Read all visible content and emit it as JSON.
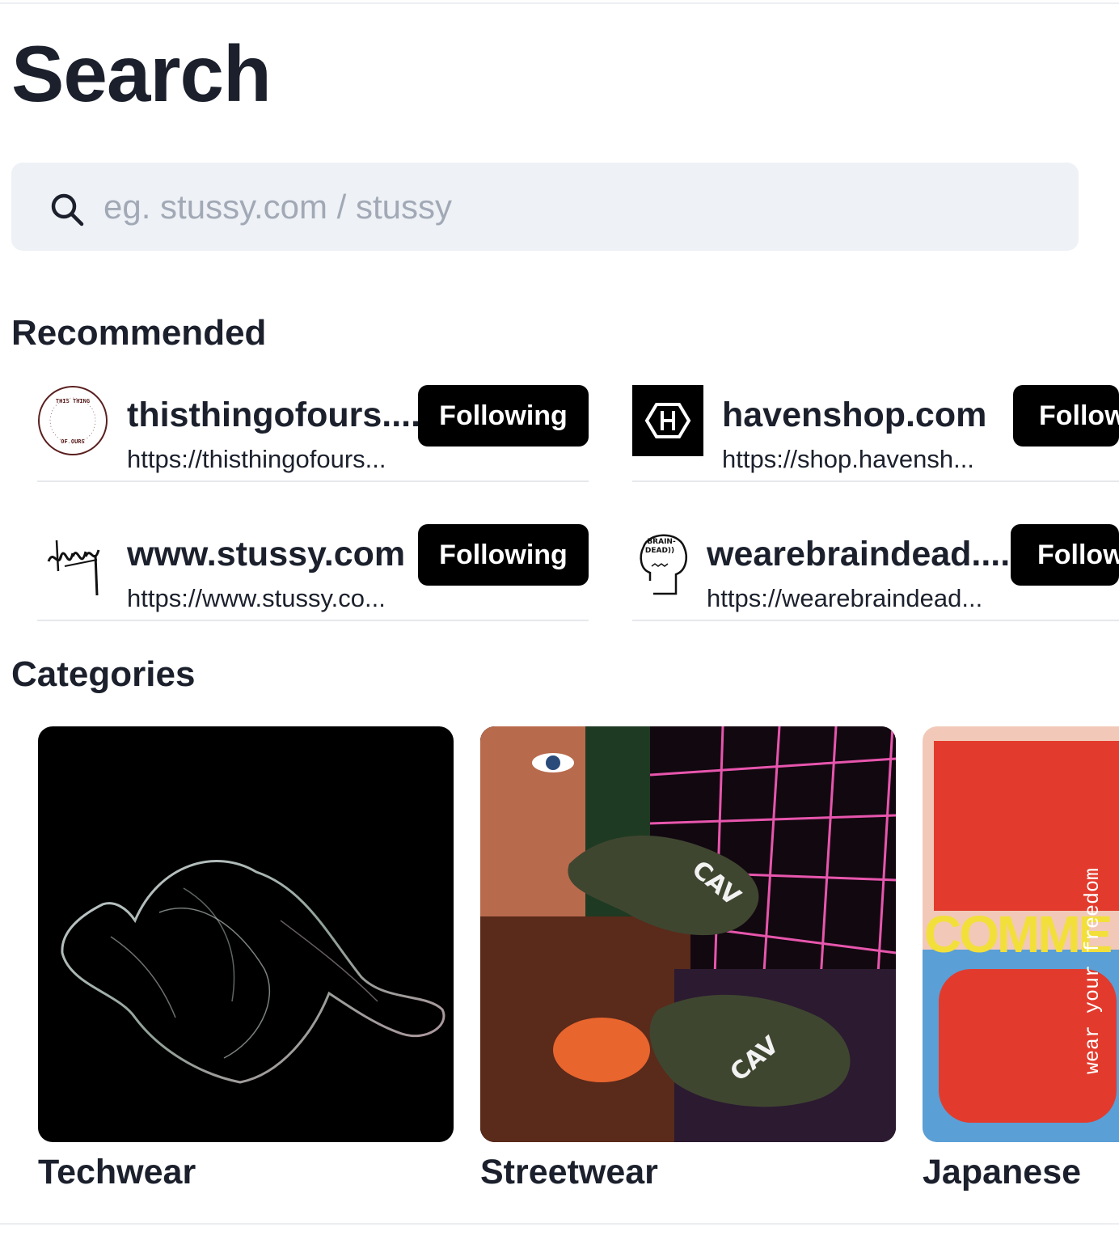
{
  "page": {
    "title": "Search"
  },
  "search": {
    "placeholder": "eg. stussy.com / stussy"
  },
  "recommended": {
    "title": "Recommended",
    "items": [
      {
        "name": "thisthingofours....",
        "url": "https://thisthingofours...",
        "button": "Following",
        "logo_text": "THIS THING OF OURS"
      },
      {
        "name": "havenshop.com",
        "url": "https://shop.havensh...",
        "button": "Following",
        "logo_text": "H"
      },
      {
        "name": "www.stussy.com",
        "url": "https://www.stussy.co...",
        "button": "Following",
        "logo_text": "Stüssy"
      },
      {
        "name": "wearebraindead....",
        "url": "https://wearebraindead...",
        "button": "Following",
        "logo_text": "BRAIN-DEAD))"
      }
    ]
  },
  "categories": {
    "title": "Categories",
    "items": [
      {
        "label": "Techwear"
      },
      {
        "label": "Streetwear"
      },
      {
        "label": "Japanese",
        "image_text_1": "COMME de",
        "image_text_2": "wear your freedom"
      }
    ]
  },
  "colors": {
    "button_bg": "#000000",
    "search_bg": "#eef1f5",
    "placeholder": "#a2a9b6",
    "text": "#1b202c"
  }
}
